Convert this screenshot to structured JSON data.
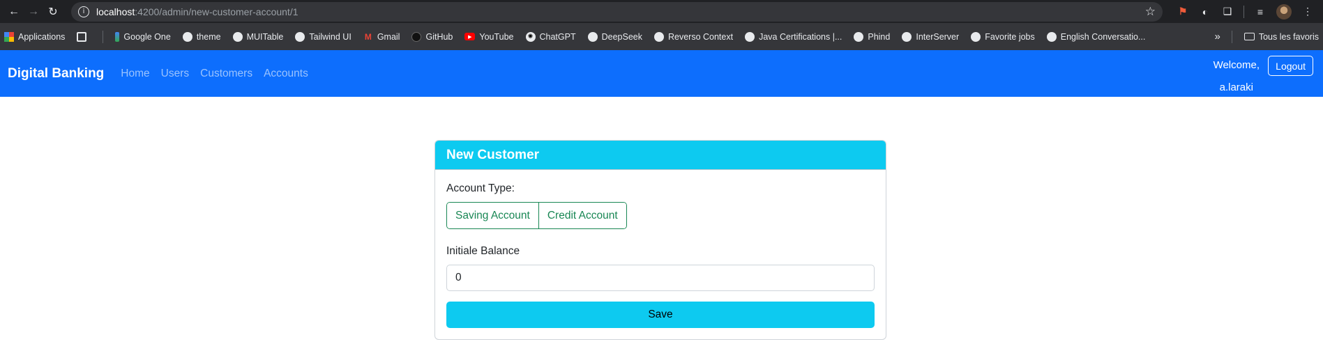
{
  "browser": {
    "url_host": "localhost",
    "url_path": ":4200/admin/new-customer-account/1"
  },
  "bookmarks": {
    "items": [
      {
        "label": "Applications",
        "icon": "apps-grid-icon"
      },
      {
        "label": "Google One",
        "icon": "google-one-icon"
      },
      {
        "label": "theme",
        "icon": "globe-icon"
      },
      {
        "label": "MUITable",
        "icon": "globe-icon"
      },
      {
        "label": "Tailwind UI",
        "icon": "globe-icon"
      },
      {
        "label": "Gmail",
        "icon": "gmail-icon"
      },
      {
        "label": "GitHub",
        "icon": "github-icon"
      },
      {
        "label": "YouTube",
        "icon": "youtube-icon"
      },
      {
        "label": "ChatGPT",
        "icon": "chatgpt-icon"
      },
      {
        "label": "DeepSeek",
        "icon": "globe-icon"
      },
      {
        "label": "Reverso Context",
        "icon": "globe-icon"
      },
      {
        "label": "Java Certifications |...",
        "icon": "globe-icon"
      },
      {
        "label": "Phind",
        "icon": "globe-icon"
      },
      {
        "label": "InterServer",
        "icon": "globe-icon"
      },
      {
        "label": "Favorite jobs",
        "icon": "globe-icon"
      },
      {
        "label": "English Conversatio...",
        "icon": "globe-icon"
      }
    ],
    "more": "»",
    "folder_label": "Tous les favoris"
  },
  "navbar": {
    "brand": "Digital Banking",
    "links": [
      "Home",
      "Users",
      "Customers",
      "Accounts"
    ],
    "welcome": "Welcome,",
    "username": "a.laraki",
    "logout": "Logout",
    "color": "#0d6efd"
  },
  "form": {
    "title": "New Customer",
    "account_type_label": "Account Type:",
    "options": [
      "Saving Account",
      "Credit Account"
    ],
    "balance_label": "Initiale Balance",
    "balance_value": "0",
    "save_label": "Save",
    "accent_color": "#0dcaf0",
    "option_color": "#198754"
  }
}
